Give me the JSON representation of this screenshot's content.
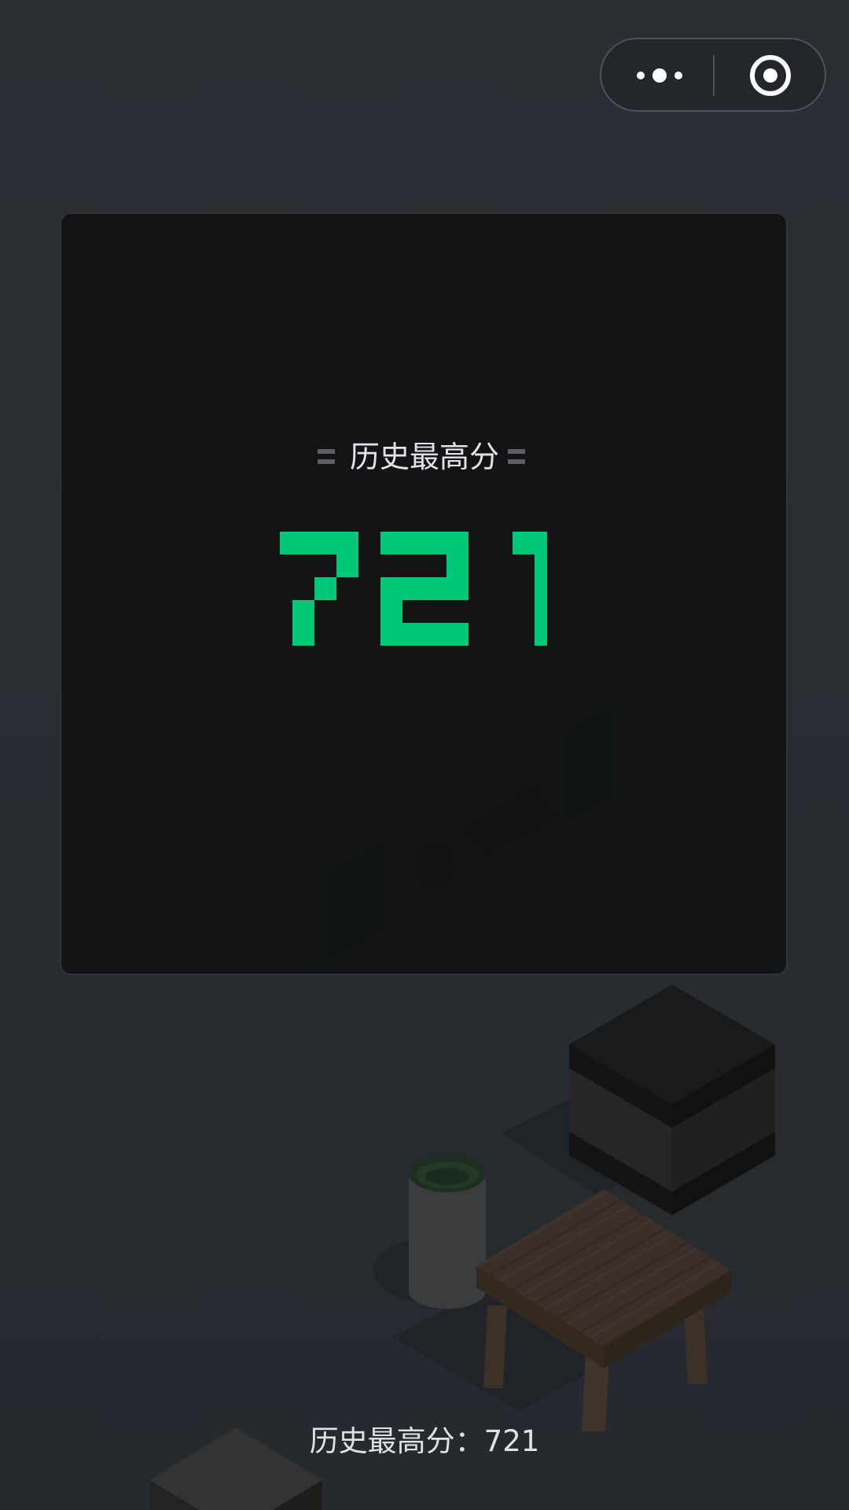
{
  "top_bar": {
    "more_icon": "more-dots-icon",
    "close_icon": "target-close-icon"
  },
  "panel": {
    "title": "历史最高分",
    "score": "721",
    "score_color": "#00c878"
  },
  "footer": {
    "best_score_text": "历史最高分：721"
  }
}
